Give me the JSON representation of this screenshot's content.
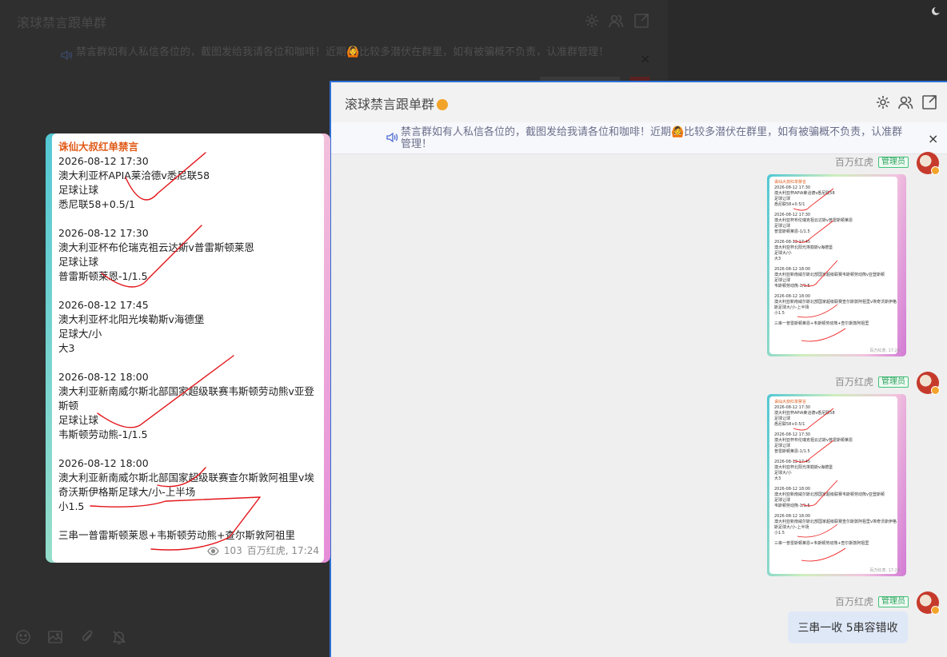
{
  "bg_window": {
    "title": "滚球禁言跟单群",
    "notice": "禁言群如有人私信各位的，截图发给我请各位和咖啡！近期🙆比较多潜伏在群里，如有被骗概不负责，认准群管理！",
    "close": "×"
  },
  "fg_window": {
    "title": "滚球禁言跟单群",
    "notice": "禁言群如有人私信各位的，截图发给我请各位和咖啡！近期🙆比较多潜伏在群里，如有被骗概不负责，认准群管理！",
    "close": "×"
  },
  "sender": {
    "name": "百万红虎",
    "role": "管理员"
  },
  "receipt": {
    "header": "诛仙大叔红单禁言",
    "blocks": [
      {
        "lines": [
          "2026-08-12 17:30",
          "澳大利亚杯APIA莱洽德v悉尼联58",
          "足球让球",
          "悉尼联58+0.5/1"
        ]
      },
      {
        "lines": [
          "2026-08-12 17:30",
          "澳大利亚杯布伦瑞克祖云达斯v普雷斯顿莱恩",
          "足球让球",
          "普雷斯顿莱恩-1/1.5"
        ]
      },
      {
        "lines": [
          "2026-08-12 17:45",
          "澳大利亚杯北阳光埃勒斯v海德堡",
          "足球大/小",
          "大3"
        ]
      },
      {
        "lines": [
          "2026-08-12 18:00",
          "澳大利亚新南威尔斯北部国家超级联赛韦斯顿劳动熊v亚登斯顿",
          "足球让球",
          "韦斯顿劳动熊-1/1.5"
        ]
      },
      {
        "lines": [
          "2026-08-12 18:00",
          "澳大利亚新南威尔斯北部国家超级联赛查尔斯敦阿祖里v埃奇沃斯伊格斯足球大/小-上半场",
          "小1.5"
        ]
      }
    ],
    "summary": "三串一普雷斯顿莱恩+韦斯顿劳动熊+查尔斯敦阿祖里",
    "views": "103",
    "footer": "百万红虎, 17:24"
  },
  "text_message": "三串一收  5串容错收"
}
